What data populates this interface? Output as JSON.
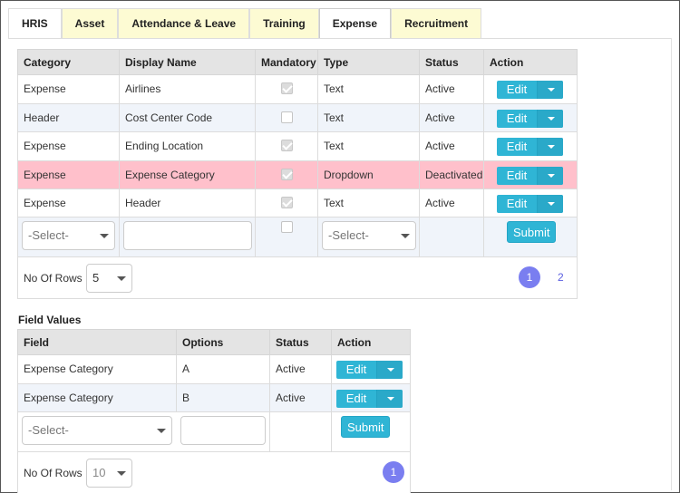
{
  "tabs": [
    "HRIS",
    "Asset",
    "Attendance & Leave",
    "Training",
    "Expense",
    "Recruitment"
  ],
  "active_tab": "Expense",
  "fields_table": {
    "headers": [
      "Category",
      "Display Name",
      "Mandatory",
      "Type",
      "Status",
      "Action"
    ],
    "rows": [
      {
        "category": "Expense",
        "display_name": "Airlines",
        "mandatory": true,
        "type": "Text",
        "status": "Active",
        "action": "Edit"
      },
      {
        "category": "Header",
        "display_name": "Cost Center Code",
        "mandatory": false,
        "type": "Text",
        "status": "Active",
        "action": "Edit"
      },
      {
        "category": "Expense",
        "display_name": "Ending Location",
        "mandatory": true,
        "type": "Text",
        "status": "Active",
        "action": "Edit"
      },
      {
        "category": "Expense",
        "display_name": "Expense Category",
        "mandatory": true,
        "type": "Dropdown",
        "status": "Deactivated",
        "action": "Edit"
      },
      {
        "category": "Expense",
        "display_name": "Header",
        "mandatory": true,
        "type": "Text",
        "status": "Active",
        "action": "Edit"
      }
    ],
    "input_row": {
      "category_select": "-Select-",
      "type_select": "-Select-",
      "submit_label": "Submit"
    },
    "footer": {
      "rows_label": "No Of Rows :",
      "rows_value": "5",
      "pages": [
        "1",
        "2"
      ],
      "current_page": "1"
    }
  },
  "field_values": {
    "title": "Field Values",
    "headers": [
      "Field",
      "Options",
      "Status",
      "Action"
    ],
    "rows": [
      {
        "field": "Expense Category",
        "option": "A",
        "status": "Active",
        "action": "Edit"
      },
      {
        "field": "Expense Category",
        "option": "B",
        "status": "Active",
        "action": "Edit"
      }
    ],
    "input_row": {
      "field_select": "-Select-",
      "submit_label": "Submit"
    },
    "footer": {
      "rows_label": "No Of Rows :",
      "rows_value": "10",
      "pages": [
        "1"
      ],
      "current_page": "1"
    }
  },
  "colors": {
    "accent": "#2fb5d5",
    "deactivated_row": "#ffc0cb",
    "tab_bg": "#fdfbd3",
    "pagination": "#7a7ef0"
  }
}
